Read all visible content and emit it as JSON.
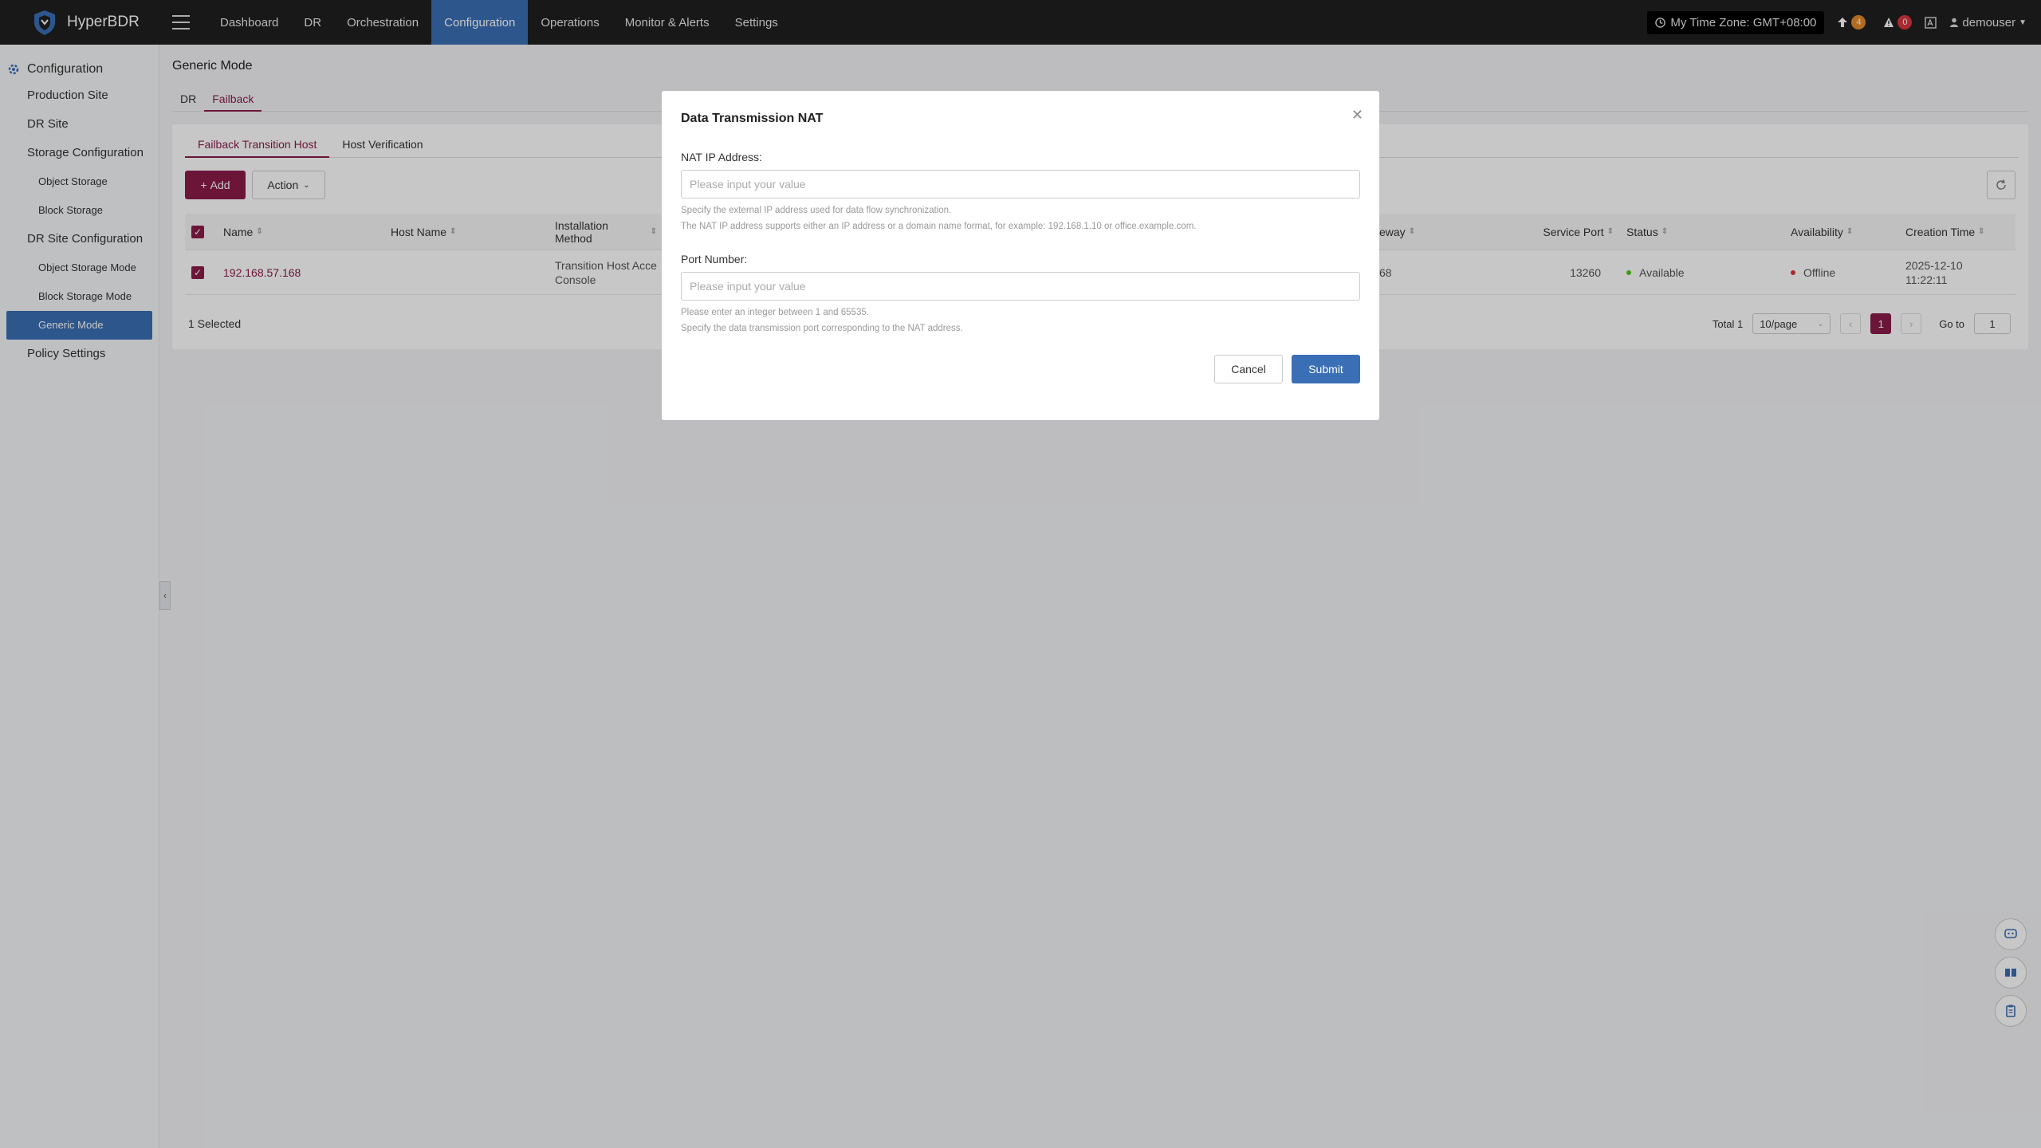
{
  "app": {
    "name": "HyperBDR"
  },
  "nav": {
    "items": [
      {
        "label": "Dashboard"
      },
      {
        "label": "DR"
      },
      {
        "label": "Orchestration"
      },
      {
        "label": "Configuration"
      },
      {
        "label": "Operations"
      },
      {
        "label": "Monitor & Alerts"
      },
      {
        "label": "Settings"
      }
    ],
    "active": "Configuration"
  },
  "topright": {
    "timezone": "My Time Zone: GMT+08:00",
    "upload_count": "4",
    "alert_count": "0",
    "username": "demouser"
  },
  "sidebar": {
    "title": "Configuration",
    "items": [
      {
        "label": "Production Site"
      },
      {
        "label": "DR Site"
      },
      {
        "label": "Storage Configuration"
      },
      {
        "label": "Object Storage"
      },
      {
        "label": "Block Storage"
      },
      {
        "label": "DR Site Configuration"
      },
      {
        "label": "Object Storage Mode"
      },
      {
        "label": "Block Storage Mode"
      },
      {
        "label": "Generic Mode"
      },
      {
        "label": "Policy Settings"
      }
    ]
  },
  "main": {
    "page_title": "Generic Mode",
    "tabs": [
      {
        "label": "DR"
      },
      {
        "label": "Failback"
      }
    ],
    "subtabs": [
      {
        "label": "Failback Transition Host"
      },
      {
        "label": "Host Verification"
      }
    ],
    "add_label": "Add",
    "action_label": "Action",
    "table": {
      "headers": {
        "name": "Name",
        "host_name": "Host Name",
        "install_method": "Installation Method",
        "gateway": "eway",
        "service_port": "Service Port",
        "status": "Status",
        "availability": "Availability",
        "creation_time": "Creation Time"
      },
      "row": {
        "name": "192.168.57.168",
        "host_name": "",
        "install_method_1": "Transition Host Acce",
        "install_method_2": "Console",
        "gateway": "68",
        "service_port": "13260",
        "status": "Available",
        "availability": "Offline",
        "creation_date": "2025-12-10",
        "creation_clock": "11:22:11"
      }
    },
    "selected_text": "1 Selected",
    "pager": {
      "total": "Total 1",
      "page_size": "10/page",
      "current_page": "1",
      "goto_label": "Go to",
      "goto_value": "1"
    }
  },
  "modal": {
    "title": "Data Transmission NAT",
    "nat_label": "NAT IP Address:",
    "nat_placeholder": "Please input your value",
    "nat_hint_1": "Specify the external IP address used for data flow synchronization.",
    "nat_hint_2": "The NAT IP address supports either an IP address or a domain name format, for example: 192.168.1.10 or office.example.com.",
    "port_label": "Port Number:",
    "port_placeholder": "Please input your value",
    "port_hint_1": "Please enter an integer between 1 and 65535.",
    "port_hint_2": "Specify the data transmission port corresponding to the NAT address.",
    "cancel_label": "Cancel",
    "submit_label": "Submit"
  },
  "colors": {
    "accent": "#8a1c4a",
    "nav_active": "#3a6fb5",
    "status_available": "#52c41a",
    "status_offline": "#d9363e"
  }
}
